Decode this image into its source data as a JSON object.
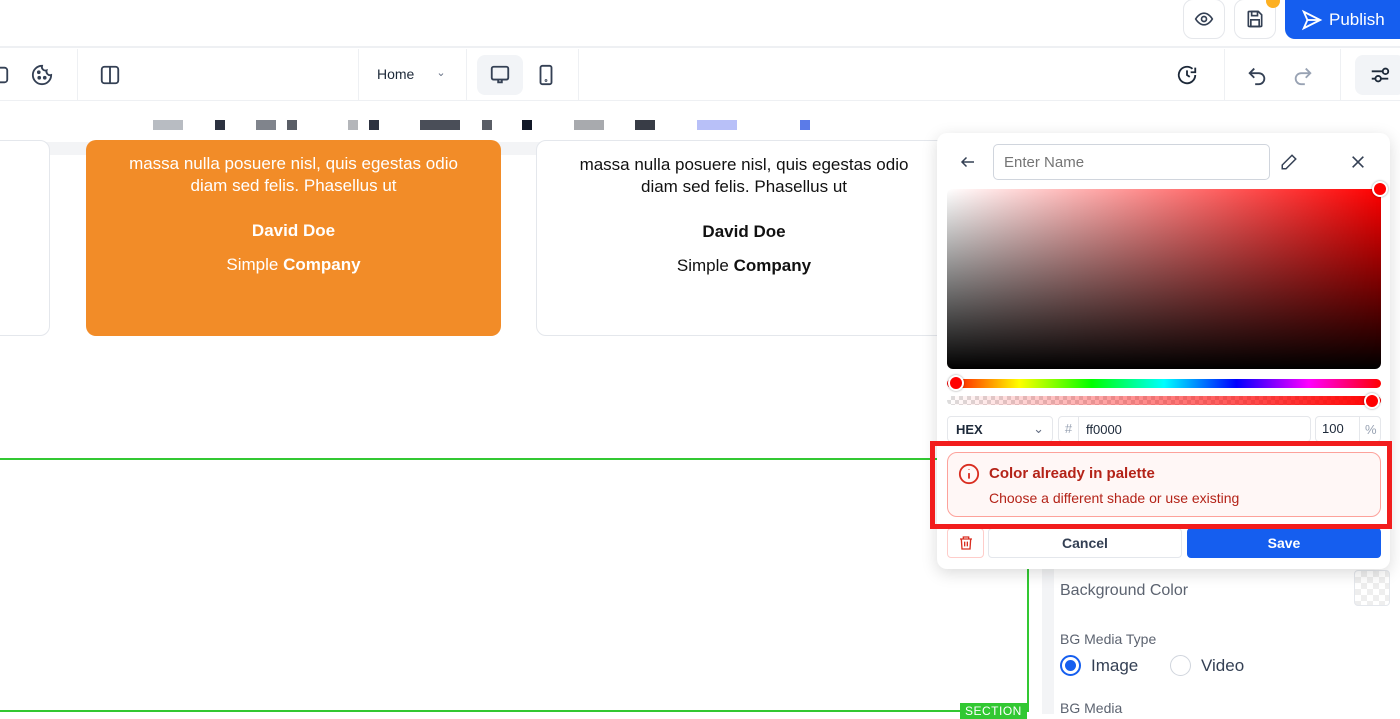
{
  "topbar": {
    "publish_label": "Publish"
  },
  "toolbar": {
    "page_select": "Home"
  },
  "cards": [
    {
      "quote": "massa nulla posuere nisl, quis egestas odio diam sed felis. Phasellus ut",
      "name": "David Doe",
      "company_prefix": "Simple",
      "company": "Company"
    },
    {
      "quote": "massa nulla posuere nisl, quis egestas odio diam sed felis. Phasellus ut",
      "name": "David Doe",
      "company_prefix": "Simple",
      "company": "Company"
    }
  ],
  "section_tag": "SECTION",
  "color_picker": {
    "name_placeholder": "Enter Name",
    "format": "HEX",
    "hash": "#",
    "hex_value": "ff0000",
    "opacity": "100",
    "percent": "%",
    "error_title": "Color already in palette",
    "error_message": "Choose a different shade or use existing",
    "cancel_label": "Cancel",
    "save_label": "Save"
  },
  "panel": {
    "bg_color_label": "Background Color",
    "bg_media_type_label": "BG Media Type",
    "options": [
      "Image",
      "Video"
    ],
    "selected": "Image",
    "bg_media_label": "BG Media"
  },
  "colors": {
    "accent": "#155eef",
    "orange": "#f28c28",
    "error": "#d92d20",
    "section": "#32c832"
  }
}
